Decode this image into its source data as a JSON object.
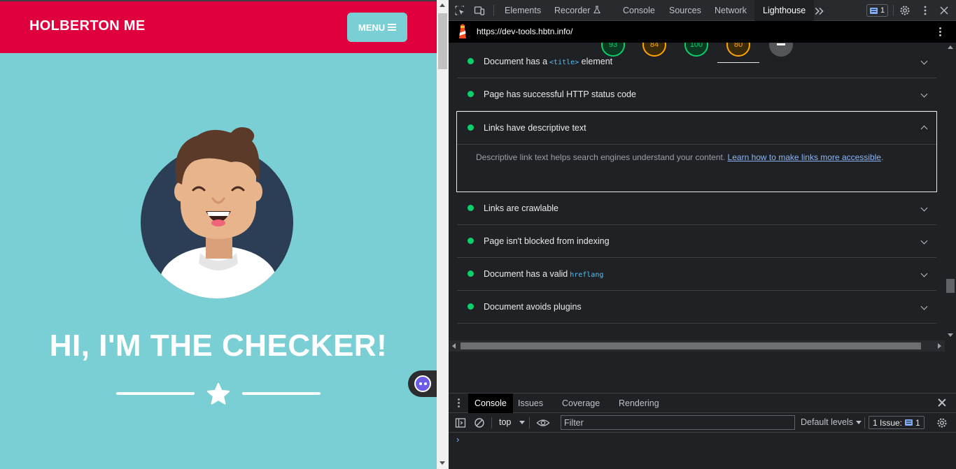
{
  "site": {
    "brand": "HOLBERTON ME",
    "menu_label": "MENU",
    "hero_title": "HI, I'M THE CHECKER!"
  },
  "devtools": {
    "tabs": [
      "Elements",
      "Recorder",
      "Console",
      "Sources",
      "Network",
      "Lighthouse"
    ],
    "active_tab": "Lighthouse",
    "issue_badge_count": "1"
  },
  "lighthouse": {
    "url": "https://dev-tools.hbtn.info/",
    "scores": [
      {
        "value": "93",
        "status": "good"
      },
      {
        "value": "84",
        "status": "average"
      },
      {
        "value": "100",
        "status": "good"
      },
      {
        "value": "80",
        "status": "average"
      }
    ],
    "audits": [
      {
        "title": "Document has a",
        "code": "<title>",
        "title_after": "element"
      },
      {
        "title": "Page has successful HTTP status code"
      },
      {
        "title": "Links have descriptive text",
        "expanded": true
      },
      {
        "title": "Links are crawlable"
      },
      {
        "title": "Page isn't blocked from indexing"
      },
      {
        "title": "Document has a valid",
        "code": "hreflang"
      },
      {
        "title": "Document avoids plugins"
      }
    ],
    "expanded_description": "Descriptive link text helps search engines understand your content.",
    "expanded_link": "Learn how to make links more accessible"
  },
  "drawer": {
    "tabs": [
      "Console",
      "Issues",
      "Coverage",
      "Rendering"
    ],
    "active_tab": "Console",
    "context": "top",
    "filter_placeholder": "Filter",
    "levels": "Default levels",
    "issues_label": "1 Issue:",
    "issues_count": "1",
    "prompt": "›"
  },
  "colors": {
    "header_red": "#e1003e",
    "teal": "#7acfd4",
    "pass_green": "#0cce6b",
    "average_orange": "#ffa400",
    "link_blue": "#8ab4f8"
  }
}
